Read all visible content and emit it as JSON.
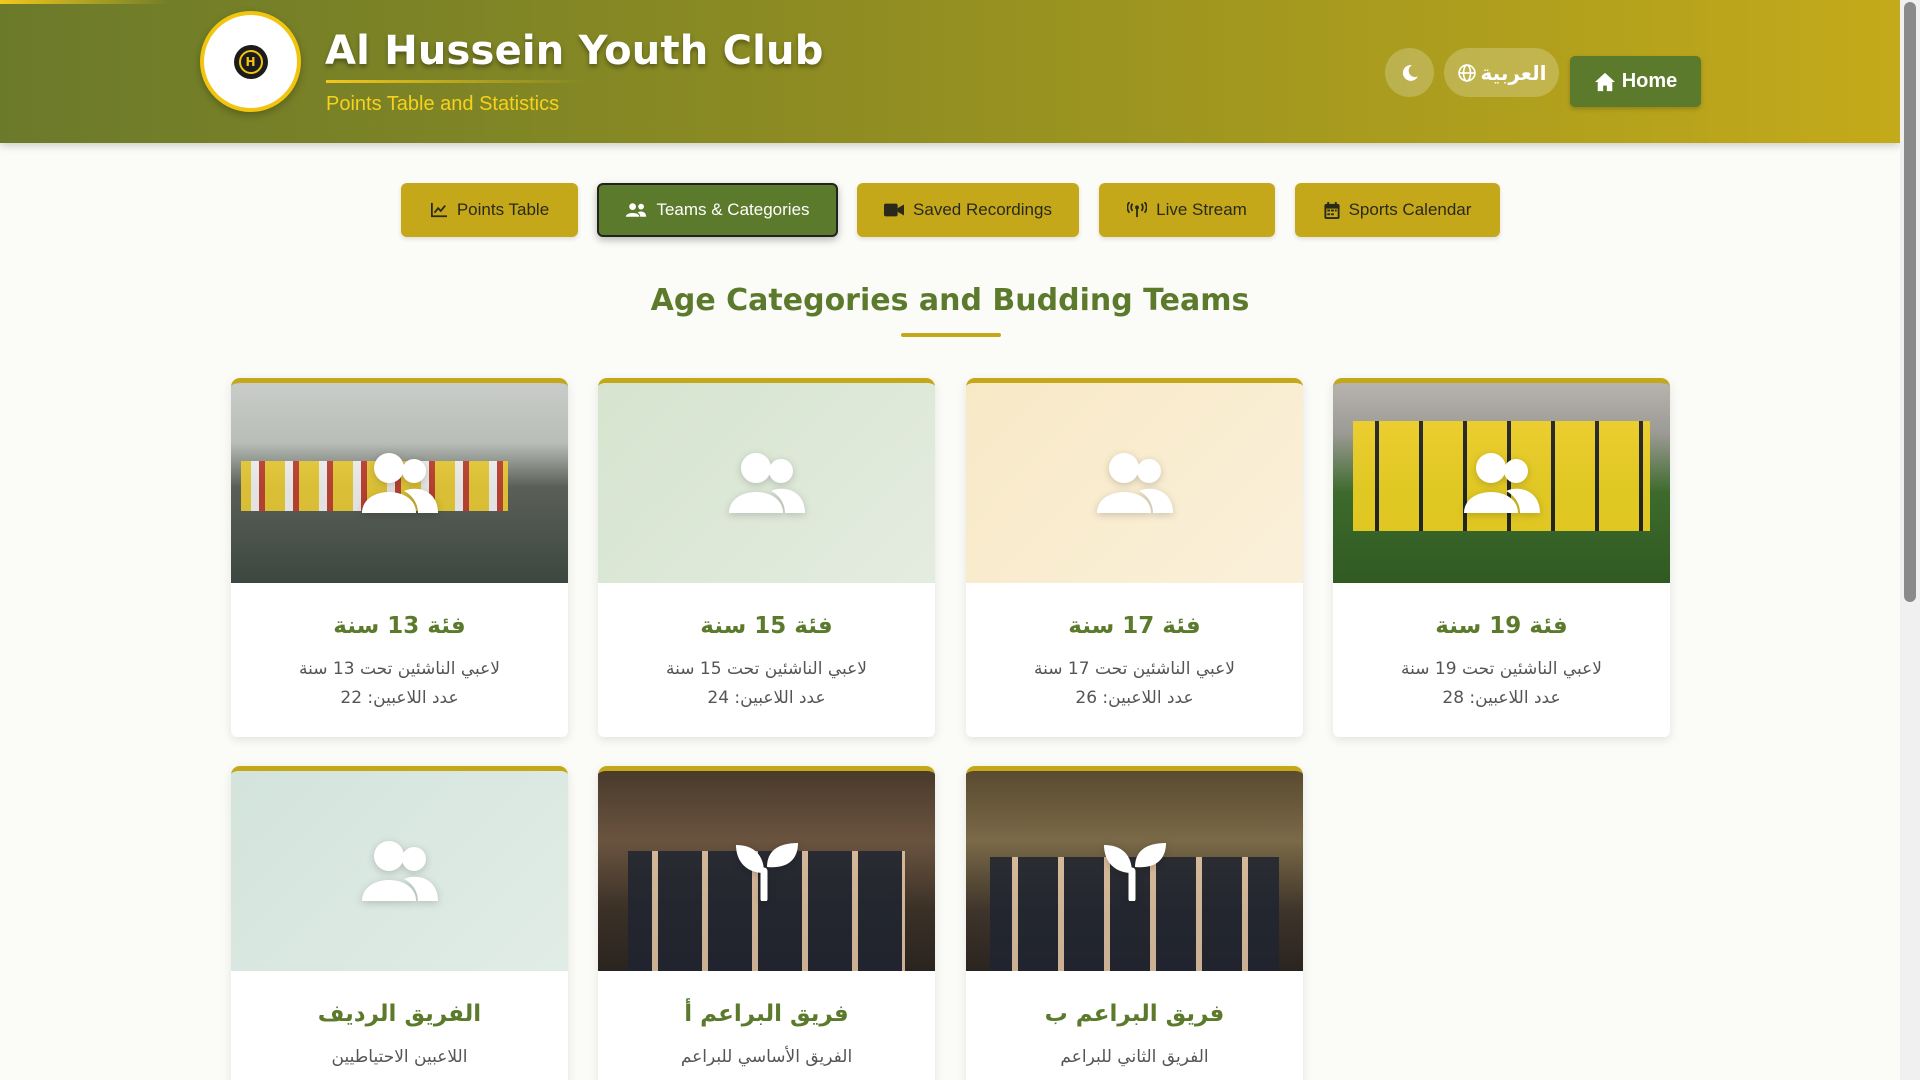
{
  "header": {
    "title": "Al Hussein Youth Club",
    "subtitle": "Points Table and Statistics",
    "logo_text": "H",
    "theme_icon": "moon-icon",
    "language_label": "العربية",
    "home_label": "Home"
  },
  "nav": {
    "tabs": [
      {
        "label": "Points Table",
        "icon": "chart-line-icon",
        "active": false
      },
      {
        "label": "Teams & Categories",
        "icon": "users-icon",
        "active": true
      },
      {
        "label": "Saved Recordings",
        "icon": "video-icon",
        "active": false
      },
      {
        "label": "Live Stream",
        "icon": "broadcast-icon",
        "active": false
      },
      {
        "label": "Sports Calendar",
        "icon": "calendar-icon",
        "active": false
      }
    ]
  },
  "section": {
    "title": "Age Categories and Budding Teams"
  },
  "cards": [
    {
      "title": "فئة 13 سنة",
      "desc": "لاعبي الناشئين تحت 13 سنة",
      "count": "عدد اللاعبين: 22",
      "icon": "users-icon",
      "media": "photo"
    },
    {
      "title": "فئة 15 سنة",
      "desc": "لاعبي الناشئين تحت 15 سنة",
      "count": "عدد اللاعبين: 24",
      "icon": "users-icon",
      "media": "placeholder"
    },
    {
      "title": "فئة 17 سنة",
      "desc": "لاعبي الناشئين تحت 17 سنة",
      "count": "عدد اللاعبين: 26",
      "icon": "users-icon",
      "media": "placeholder"
    },
    {
      "title": "فئة 19 سنة",
      "desc": "لاعبي الناشئين تحت 19 سنة",
      "count": "عدد اللاعبين: 28",
      "icon": "users-icon",
      "media": "photo"
    },
    {
      "title": "الفريق الرديف",
      "desc": "اللاعبين الاحتياطيين",
      "count": "",
      "icon": "users-icon",
      "media": "placeholder"
    },
    {
      "title": "فريق البراعم أ",
      "desc": "الفريق الأساسي للبراعم",
      "count": "",
      "icon": "seedling-icon",
      "media": "photo"
    },
    {
      "title": "فريق البراعم ب",
      "desc": "الفريق الثاني للبراعم",
      "count": "",
      "icon": "seedling-icon",
      "media": "photo"
    }
  ],
  "colors": {
    "primary_green": "#5c7a2c",
    "gold": "#c5a81a",
    "bright_gold": "#f1c40f"
  }
}
